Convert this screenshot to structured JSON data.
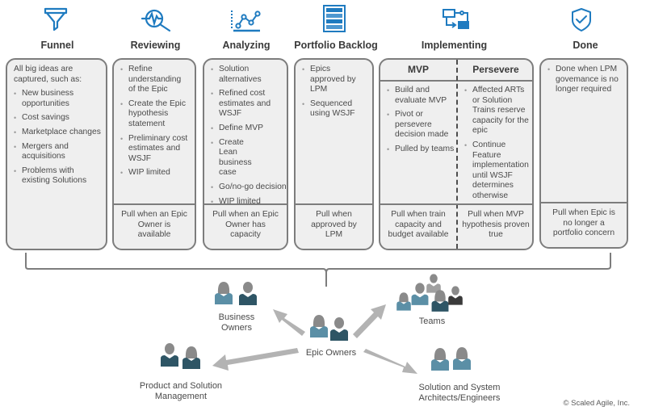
{
  "colors": {
    "icon_blue": "#1f7bc0",
    "card_fill": "#efefef",
    "card_border": "#7d7d7d",
    "person_light": "#5b8fa6",
    "person_dark": "#2e5565",
    "person_head": "#8a8a8a",
    "arrow": "#b3b3b3"
  },
  "stages": [
    {
      "icon": "funnel-icon",
      "title": "Funnel",
      "intro": "All big ideas are captured, such as:",
      "items": [
        "New business opportunities",
        "Cost savings",
        "Marketplace changes",
        "Mergers and acquisitions",
        "Problems with existing Solutions"
      ],
      "footer": ""
    },
    {
      "icon": "magnifier-pulse-icon",
      "title": "Reviewing",
      "items": [
        "Refine understanding of the Epic",
        "Create the Epic hypothesis statement",
        "Preliminary cost estimates and WSJF",
        "WIP limited"
      ],
      "footer": "Pull when an Epic Owner is available"
    },
    {
      "icon": "line-chart-icon",
      "title": "Analyzing",
      "items": [
        "Solution alternatives",
        "Refined cost estimates and WSJF",
        "Define MVP",
        "Create Lean business case",
        "Go/no-go decision",
        "WIP limited"
      ],
      "footer": "Pull when an Epic Owner has capacity"
    },
    {
      "icon": "backlog-stack-icon",
      "title": "Portfolio Backlog",
      "items": [
        "Epics approved by LPM",
        "Sequenced using WSJF"
      ],
      "footer": "Pull when approved by LPM"
    },
    {
      "icon": "flow-process-icon",
      "title": "Implementing",
      "mvp": {
        "heading": "MVP",
        "items": [
          "Build and evaluate MVP",
          "Pivot or persevere decision made",
          "Pulled by teams"
        ],
        "footer": "Pull when train capacity and budget available"
      },
      "persevere": {
        "heading": "Persevere",
        "items": [
          "Affected ARTs or Solution Trains reserve capacity for the epic",
          "Continue Feature implementation until WSJF determines otherwise"
        ],
        "footer": "Pull when MVP hypothesis proven true"
      }
    },
    {
      "icon": "shield-check-icon",
      "title": "Done",
      "items": [
        "Done when LPM govemance is no longer required"
      ],
      "footer": "Pull when Epic is no longer a portfolio concern"
    }
  ],
  "roles": {
    "center": "Epic Owners",
    "business_owners": "Business Owners",
    "teams": "Teams",
    "product_management": "Product and Solution Management",
    "architects": "Solution and System Architects/Engineers"
  },
  "copyright": "© Scaled Agile, Inc."
}
